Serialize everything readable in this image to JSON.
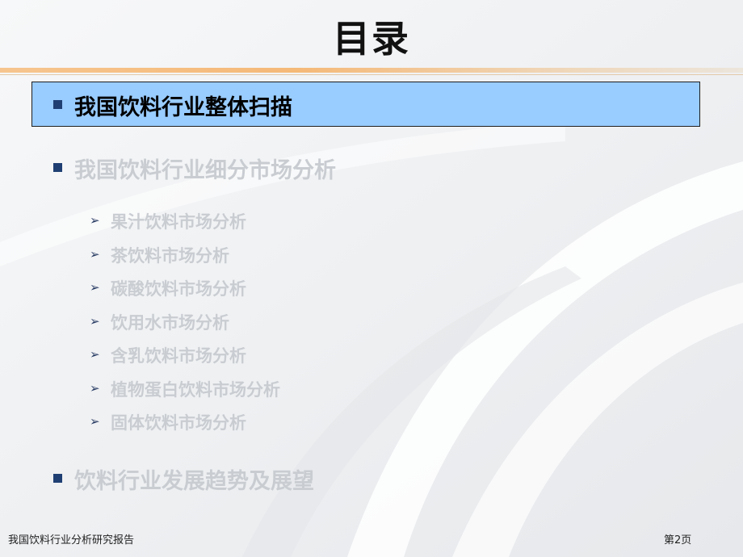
{
  "slide": {
    "title": "目录",
    "sections": [
      {
        "label": "我国饮料行业整体扫描",
        "active": true
      },
      {
        "label": "我国饮料行业细分市场分析",
        "active": false
      },
      {
        "label": "饮料行业发展趋势及展望",
        "active": false
      }
    ],
    "subitems": [
      " 果汁饮料市场分析",
      "茶饮料市场分析",
      "碳酸饮料市场分析",
      "饮用水市场分析",
      "含乳饮料市场分析",
      "植物蛋白饮料市场分析",
      "固体饮料市场分析"
    ],
    "bullet_glyph": "■",
    "arrow_glyph": "➢"
  },
  "footer": {
    "doc_title": "我国饮料行业分析研究报告",
    "page_label": "第2页"
  },
  "colors": {
    "highlight": "#99ccff",
    "bullet": "#1f3f73",
    "dim_text": "#c9cdd2",
    "title_rule": "#f5b978"
  }
}
